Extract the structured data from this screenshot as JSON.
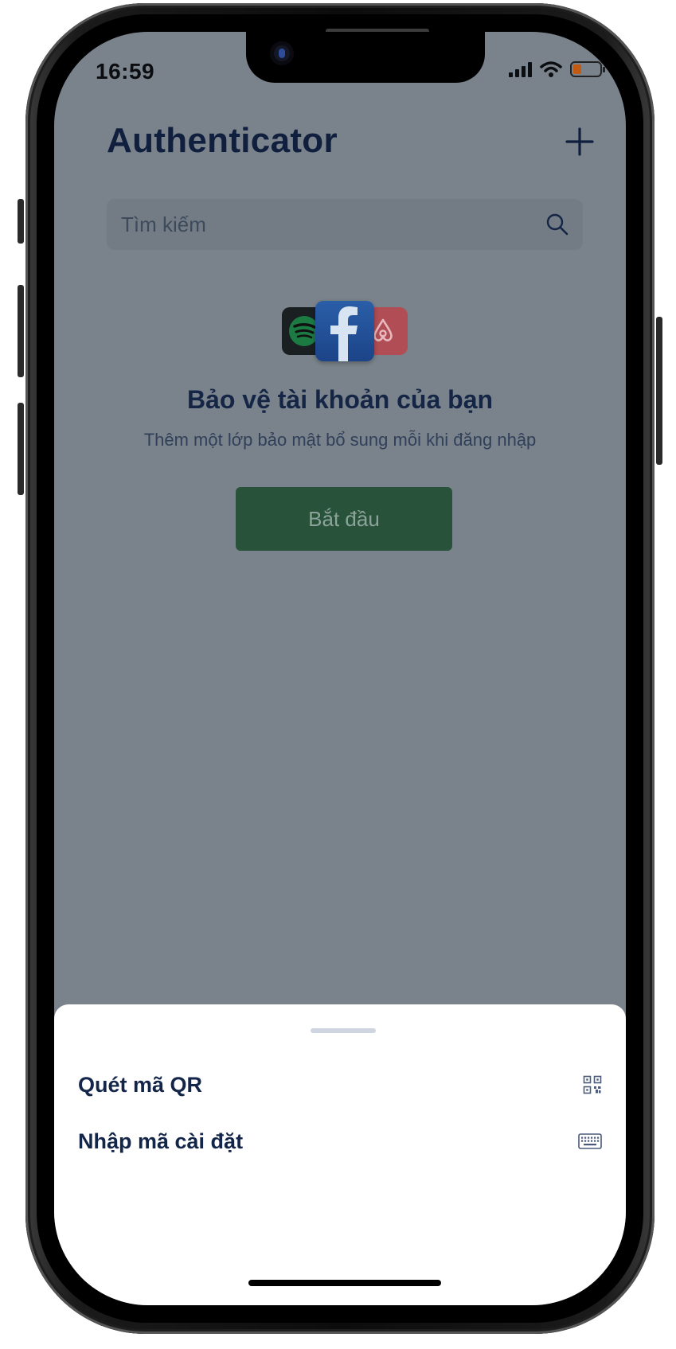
{
  "status_bar": {
    "time": "16:59"
  },
  "header": {
    "title": "Authenticator"
  },
  "search": {
    "placeholder": "Tìm kiếm"
  },
  "empty_state": {
    "logos": [
      "spotify-logo",
      "facebook-logo",
      "airbnb-logo"
    ],
    "title": "Bảo vệ tài khoản của bạn",
    "subtitle": "Thêm một lớp bảo mật bổ sung mỗi khi đăng nhập",
    "start_label": "Bắt đầu"
  },
  "bottom_sheet": {
    "items": [
      {
        "label": "Quét mã QR",
        "icon": "qr-code-icon"
      },
      {
        "label": "Nhập mã cài đặt",
        "icon": "keyboard-icon"
      }
    ]
  },
  "colors": {
    "overlay": "#7a838b",
    "title": "#0f1f3d",
    "primary_button": "#28523a",
    "battery": "#c35a12",
    "sheet": "#ffffff"
  }
}
